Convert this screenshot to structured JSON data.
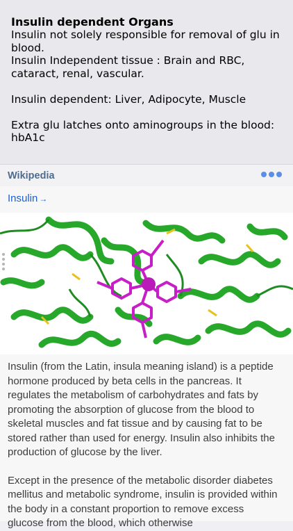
{
  "note": {
    "title": "Insulin dependent Organs",
    "body": "Insulin not solely responsible for removal of glu in blood.\nInsulin Independent tissue : Brain and RBC, cataract, renal, vascular.\n\nInsulin dependent: Liver, Adipocyte, Muscle\n\nExtra glu latches onto aminogroups in the blood: hbA1c"
  },
  "wiki": {
    "source_label": "Wikipedia",
    "more_icon": "ellipsis-icon",
    "article_link": "Insulin",
    "link_arrow": "→",
    "paragraphs": [
      "Insulin (from the Latin, insula meaning island) is a peptide hormone produced by beta cells in the pancreas. It regulates the metabolism of carbohydrates and fats by promoting the absorption of glucose from the blood to skeletal muscles and fat tissue and by causing fat to be stored rather than used for energy. Insulin also inhibits the production of glucose by the liver.",
      "Except in the presence of the metabolic disorder diabetes mellitus and metabolic syndrome, insulin is provided within the body in a constant proportion to remove excess glucose from the blood, which otherwise"
    ]
  },
  "colors": {
    "link": "#1a5fd6",
    "wiki_label": "#4f6c8c",
    "dots": "#5b8ee5",
    "protein_green": "#2fb52f",
    "ligand_magenta": "#c71fc7"
  }
}
